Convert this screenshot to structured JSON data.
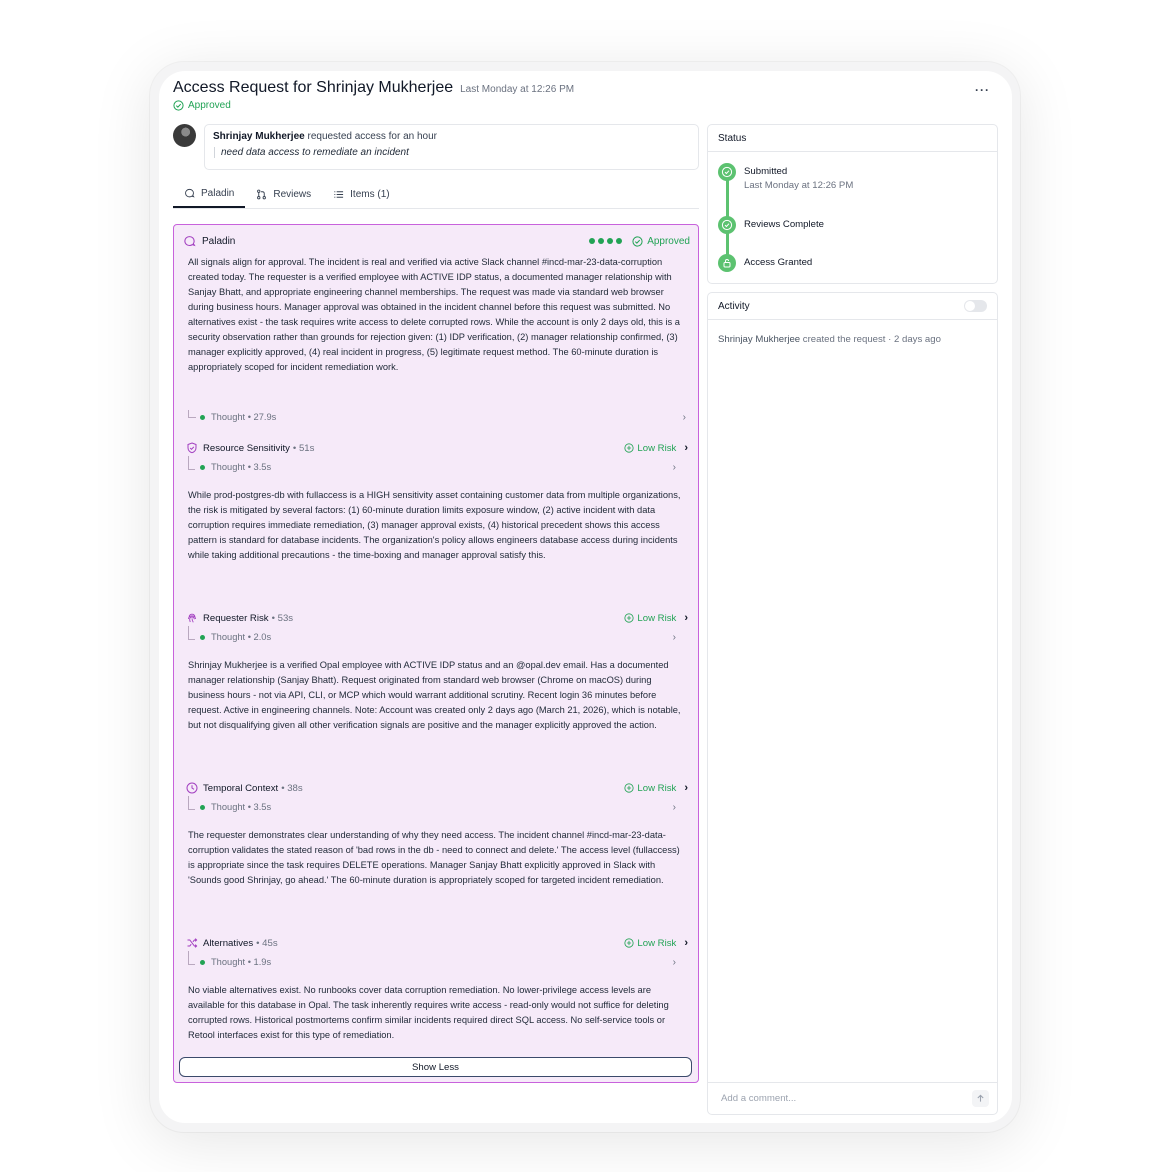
{
  "header": {
    "title": "Access Request for Shrinjay Mukherjee",
    "time": "Last Monday at 12:26 PM",
    "status": "Approved",
    "more_icon": "ellipsis-icon"
  },
  "request": {
    "requester": "Shrinjay Mukherjee",
    "action": "requested access for an hour",
    "reason": "need data access to remediate an incident"
  },
  "tabs": [
    {
      "label": "Paladin",
      "icon": "paladin-icon"
    },
    {
      "label": "Reviews",
      "icon": "pull-request-icon"
    },
    {
      "label": "Items (1)",
      "icon": "list-icon"
    }
  ],
  "paladin": {
    "label": "Paladin",
    "status": "Approved",
    "progress_dots": 4,
    "summary": "All signals align for approval. The incident is real and verified via active Slack channel #incd-mar-23-data-corruption created today. The requester is a verified employee with ACTIVE IDP status, a documented manager relationship with Sanjay Bhatt, and appropriate engineering channel memberships. The request was made via standard web browser during business hours. Manager approval was obtained in the incident channel before this request was submitted. No alternatives exist - the task requires write access to delete corrupted rows. While the account is only 2 days old, this is a security observation rather than grounds for rejection given: (1) IDP verification, (2) manager relationship confirmed, (3) manager explicitly approved, (4) real incident in progress, (5) legitimate request method. The 60-minute duration is appropriately scoped for incident remediation work.",
    "thought": "Thought • 27.9s",
    "sections": [
      {
        "title": "Resource Sensitivity",
        "duration": "• 51s",
        "risk": "Low Risk",
        "thought": "Thought • 3.5s",
        "body": "While prod-postgres-db with fullaccess is a HIGH sensitivity asset containing customer data from multiple organizations, the risk is mitigated by several factors: (1) 60-minute duration limits exposure window, (2) active incident with data corruption requires immediate remediation, (3) manager approval exists, (4) historical precedent shows this access pattern is standard for database incidents. The organization's policy allows engineers database access during incidents while taking additional precautions - the time-boxing and manager approval satisfy this."
      },
      {
        "title": "Requester Risk",
        "duration": "• 53s",
        "risk": "Low Risk",
        "thought": "Thought • 2.0s",
        "body": "Shrinjay Mukherjee is a verified Opal employee with ACTIVE IDP status and an @opal.dev email. Has a documented manager relationship (Sanjay Bhatt). Request originated from standard web browser (Chrome on macOS) during business hours - not via API, CLI, or MCP which would warrant additional scrutiny. Recent login 36 minutes before request. Active in engineering channels. Note: Account was created only 2 days ago (March 21, 2026), which is notable, but not disqualifying given all other verification signals are positive and the manager explicitly approved the action."
      },
      {
        "title": "Temporal Context",
        "duration": "• 38s",
        "risk": "Low Risk",
        "thought": "Thought • 3.5s",
        "body": "The requester demonstrates clear understanding of why they need access. The incident channel #incd-mar-23-data-corruption validates the stated reason of 'bad rows in the db - need to connect and delete.' The access level (fullaccess) is appropriate since the task requires DELETE operations. Manager Sanjay Bhatt explicitly approved in Slack with 'Sounds good Shrinjay, go ahead.' The 60-minute duration is appropriately scoped for targeted incident remediation."
      },
      {
        "title": "Alternatives",
        "duration": "• 45s",
        "risk": "Low Risk",
        "thought": "Thought • 1.9s",
        "body": "No viable alternatives exist. No runbooks cover data corruption remediation. No lower-privilege access levels are available for this database in Opal. The task inherently requires write access - read-only would not suffice for deleting corrupted rows. Historical postmortems confirm similar incidents required direct SQL access. No self-service tools or Retool interfaces exist for this type of remediation."
      }
    ],
    "show_less": "Show Less"
  },
  "status_card": {
    "title": "Status",
    "steps": [
      {
        "label": "Submitted",
        "sub": "Last Monday at 12:26 PM"
      },
      {
        "label": "Reviews Complete",
        "sub": ""
      },
      {
        "label": "Access Granted",
        "sub": ""
      }
    ]
  },
  "activity": {
    "title": "Activity",
    "entry_who": "Shrinjay Mukherjee",
    "entry_rest": "created the request · 2 days ago",
    "comment_placeholder": "Add a comment..."
  },
  "colors": {
    "accent_green": "#22a355",
    "panel_border": "#c862dc",
    "panel_bg": "#f6eaf9"
  }
}
